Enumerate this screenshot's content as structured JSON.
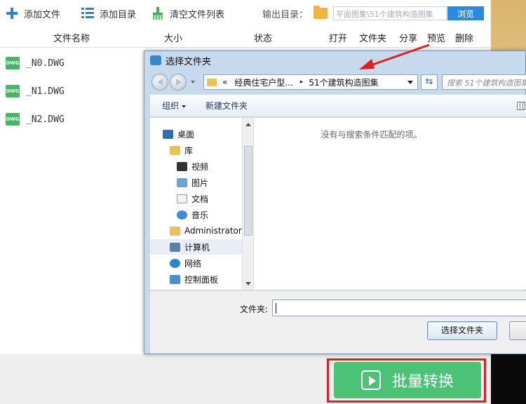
{
  "toolbar": {
    "add_file": "添加文件",
    "add_dir": "添加目录",
    "clear_list": "清空文件列表",
    "output_label": "输出目录：",
    "output_path": "平面图集\\51个建筑构造图集",
    "browse": "浏览"
  },
  "table": {
    "headers": [
      "文件名称",
      "大小",
      "状态",
      "打开",
      "文件夹",
      "分享",
      "预览",
      "删除"
    ]
  },
  "files": [
    {
      "badge": "DWG",
      "name": "_N0.DWG"
    },
    {
      "badge": "DWG",
      "name": "_N1.DWG"
    },
    {
      "badge": "DWG",
      "name": "_N2.DWG"
    }
  ],
  "convert_button": "批量转换",
  "dialog": {
    "title": "选择文件夹",
    "address": {
      "prefix": "«",
      "parent": "经典住宅户型...",
      "current": "51个建筑构造图集"
    },
    "search_placeholder": "搜索 51个建筑构造图集",
    "commands": {
      "organize": "组织",
      "new_folder": "新建文件夹"
    },
    "tree": [
      {
        "label": "桌面",
        "icon": "desktop-icon",
        "level": 0
      },
      {
        "label": "库",
        "icon": "library-icon",
        "level": 0
      },
      {
        "label": "视频",
        "icon": "video-icon",
        "level": 1
      },
      {
        "label": "图片",
        "icon": "picture-icon",
        "level": 1
      },
      {
        "label": "文档",
        "icon": "document-icon",
        "level": 1
      },
      {
        "label": "音乐",
        "icon": "music-icon",
        "level": 1
      },
      {
        "label": "Administrator",
        "icon": "user-folder-icon",
        "level": 0
      },
      {
        "label": "计算机",
        "icon": "computer-icon",
        "level": 0
      },
      {
        "label": "网络",
        "icon": "network-icon",
        "level": 0
      },
      {
        "label": "控制面板",
        "icon": "control-panel-icon",
        "level": 0
      }
    ],
    "empty_message": "没有与搜索条件匹配的项。",
    "folder_label": "文件夹:",
    "folder_value": "",
    "select_button": "选择文件夹"
  },
  "colors": {
    "accent_blue": "#2a8ae0",
    "convert_green": "#4bc276",
    "highlight_red": "#e02020",
    "dwg_green": "#48b565"
  }
}
